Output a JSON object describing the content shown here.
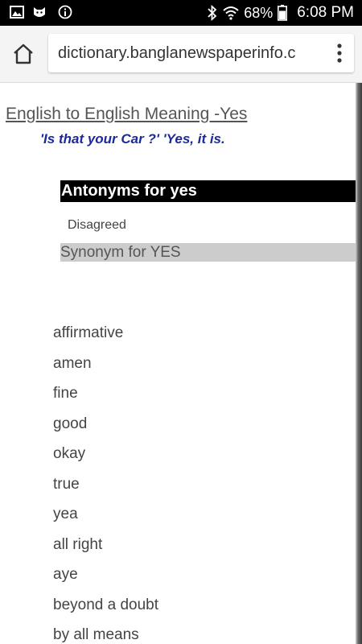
{
  "status_bar": {
    "battery": "68%",
    "time": "6:08 PM",
    "left_icons": [
      "gallery-icon",
      "cat-app-icon",
      "info-icon"
    ],
    "right_icons": [
      "bluetooth-icon",
      "wifi-icon",
      "battery-icon"
    ]
  },
  "browser": {
    "url": "dictionary.banglanewspaperinfo.c"
  },
  "page": {
    "heading": "English to English Meaning -Yes ",
    "example": "'Is that your Car ?' 'Yes, it is.",
    "antonyms_title": "Antonyms for yes",
    "antonyms": [
      "Disagreed"
    ],
    "synonyms_title": "Synonym for YES",
    "synonyms": [
      "affirmative",
      "amen",
      "fine",
      "good",
      "okay",
      "true",
      "yea",
      "all right",
      "aye",
      "beyond a doubt",
      "by all means"
    ]
  }
}
